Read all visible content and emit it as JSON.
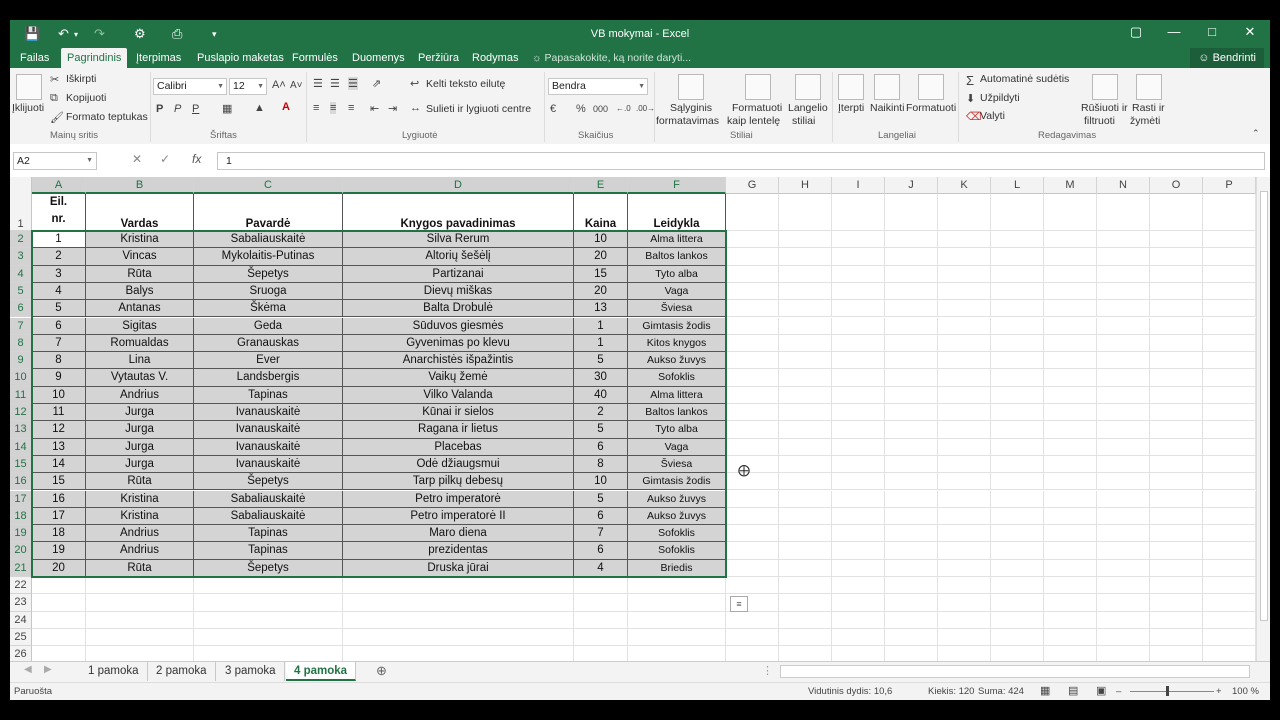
{
  "window": {
    "title": "VB mokymai - Excel"
  },
  "menu": {
    "tabs": [
      "Failas",
      "Pagrindinis",
      "Įterpimas",
      "Puslapio maketas",
      "Formulės",
      "Duomenys",
      "Peržiūra",
      "Rodymas"
    ],
    "active": "Pagrindinis",
    "tell_me": "Papasakokite, ką norite daryti...",
    "share": "Bendrinti"
  },
  "ribbon": {
    "clipboard": {
      "paste": "Įklijuoti",
      "cut": "Iškirpti",
      "copy": "Kopijuoti",
      "format_painter": "Formato teptukas",
      "label": "Mainų sritis"
    },
    "font": {
      "name": "Calibri",
      "size": "12",
      "bold": "P",
      "italic": "P",
      "underline": "P",
      "label": "Šriftas"
    },
    "alignment": {
      "wrap": "Kelti teksto eilutę",
      "merge": "Sulieti ir lygiuoti centre",
      "label": "Lygiuotė"
    },
    "number": {
      "format": "Bendra",
      "percent": "%",
      "thousands": "000",
      "label": "Skaičius"
    },
    "styles": {
      "conditional": [
        "Sąlyginis",
        "formatavimas"
      ],
      "table": [
        "Formatuoti",
        "kaip lentelę"
      ],
      "cell": [
        "Langelio",
        "stiliai"
      ],
      "label": "Stiliai"
    },
    "cells": {
      "insert": "Įterpti",
      "delete": "Naikinti",
      "format": "Formatuoti",
      "label": "Langeliai"
    },
    "editing": {
      "autosum": "Automatinė sudėtis",
      "fill": "Užpildyti",
      "clear": "Valyti",
      "sort": [
        "Rūšiuoti ir",
        "filtruoti"
      ],
      "find": [
        "Rasti ir",
        "žymėti"
      ],
      "label": "Redagavimas"
    }
  },
  "formula_bar": {
    "name_box": "A2",
    "fx": "fx",
    "value": "1"
  },
  "columns": [
    "A",
    "B",
    "C",
    "D",
    "E",
    "F",
    "G",
    "H",
    "I",
    "J",
    "K",
    "L",
    "M",
    "N",
    "O",
    "P"
  ],
  "rows": [
    "1",
    "2",
    "3",
    "4",
    "5",
    "6",
    "7",
    "8",
    "9",
    "10",
    "11",
    "12",
    "13",
    "14",
    "15",
    "16",
    "17",
    "18",
    "19",
    "20",
    "21",
    "22",
    "23",
    "24",
    "25",
    "26"
  ],
  "table": {
    "headers": [
      "Eil. nr.",
      "Vardas",
      "Pavardė",
      "Knygos pavadinimas",
      "Kaina",
      "Leidykla"
    ],
    "header_a_line1": "Eil.",
    "header_a_line2": "nr.",
    "data": [
      [
        "1",
        "Kristina",
        "Sabaliauskaitė",
        "Silva Rerum",
        "10",
        "Alma littera"
      ],
      [
        "2",
        "Vincas",
        "Mykolaitis-Putinas",
        "Altorių šešėlį",
        "20",
        "Baltos lankos"
      ],
      [
        "3",
        "Rūta",
        "Šepetys",
        "Partizanai",
        "15",
        "Tyto alba"
      ],
      [
        "4",
        "Balys",
        "Sruoga",
        "Dievų miškas",
        "20",
        "Vaga"
      ],
      [
        "5",
        "Antanas",
        "Škėma",
        "Balta Drobulė",
        "13",
        "Šviesa"
      ],
      [
        "6",
        "Sigitas",
        "Geda",
        "Sūduvos giesmės",
        "1",
        "Gimtasis žodis"
      ],
      [
        "7",
        "Romualdas",
        "Granauskas",
        "Gyvenimas po klevu",
        "1",
        "Kitos knygos"
      ],
      [
        "8",
        "Lina",
        "Ever",
        "Anarchistės išpažintis",
        "5",
        "Aukso žuvys"
      ],
      [
        "9",
        "Vytautas V.",
        "Landsbergis",
        "Vaikų žemė",
        "30",
        "Sofoklis"
      ],
      [
        "10",
        "Andrius",
        "Tapinas",
        "Vilko Valanda",
        "40",
        "Alma littera"
      ],
      [
        "11",
        "Jurga",
        "Ivanauskaitė",
        "Kūnai ir sielos",
        "2",
        "Baltos lankos"
      ],
      [
        "12",
        "Jurga",
        "Ivanauskaitė",
        "Ragana ir lietus",
        "5",
        "Tyto alba"
      ],
      [
        "13",
        "Jurga",
        "Ivanauskaitė",
        "Placebas",
        "6",
        "Vaga"
      ],
      [
        "14",
        "Jurga",
        "Ivanauskaitė",
        "Odė džiaugsmui",
        "8",
        "Šviesa"
      ],
      [
        "15",
        "Rūta",
        "Šepetys",
        "Tarp pilkų debesų",
        "10",
        "Gimtasis žodis"
      ],
      [
        "16",
        "Kristina",
        "Sabaliauskaitė",
        "Petro imperatorė",
        "5",
        "Aukso žuvys"
      ],
      [
        "17",
        "Kristina",
        "Sabaliauskaitė",
        "Petro imperatorė II",
        "6",
        "Aukso žuvys"
      ],
      [
        "18",
        "Andrius",
        "Tapinas",
        "Maro diena",
        "7",
        "Sofoklis"
      ],
      [
        "19",
        "Andrius",
        "Tapinas",
        "prezidentas",
        "6",
        "Sofoklis"
      ],
      [
        "20",
        "Rūta",
        "Šepetys",
        "Druska jūrai",
        "4",
        "Briedis"
      ]
    ]
  },
  "sheets": [
    "1 pamoka",
    "2 pamoka",
    "3 pamoka",
    "4 pamoka"
  ],
  "active_sheet": "4 pamoka",
  "status": {
    "ready": "Paruošta",
    "average": "Vidutinis dydis: 10,6",
    "count": "Kiekis: 120",
    "sum": "Suma: 424",
    "zoom": "100 %"
  },
  "colors": {
    "accent": "#217346",
    "table_fill": "#d4d4d4"
  }
}
